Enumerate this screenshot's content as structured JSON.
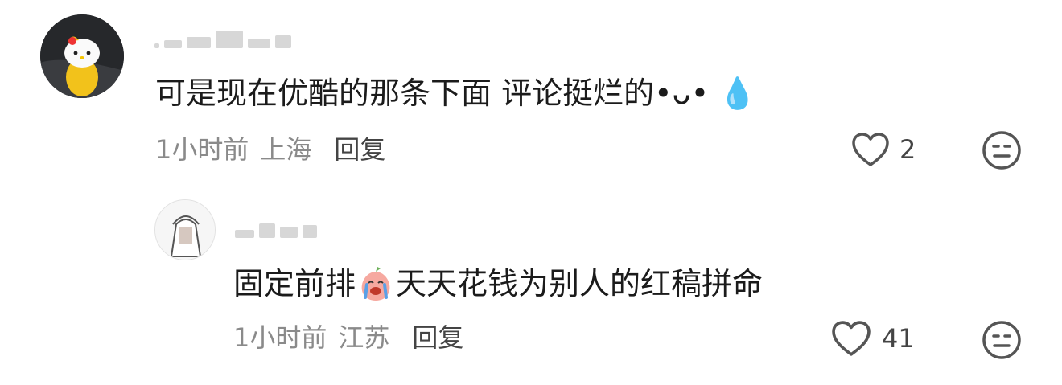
{
  "comments": [
    {
      "text": "可是现在优酷的那条下面 评论挺烂的•ᴗ• 💧",
      "time": "1小时前",
      "location": "上海",
      "reply_label": "回复",
      "likes": "2"
    },
    {
      "text_before_emoji": "固定前排",
      "text_after_emoji": "天天花钱为别人的红稿拼命",
      "time": "1小时前",
      "location": "江苏",
      "reply_label": "回复",
      "likes": "41"
    }
  ],
  "icons": {
    "like": "heart-outline-icon",
    "dislike": "meh-face-icon",
    "inline_emoji": "crying-peach-emoji"
  },
  "colors": {
    "text": "#1b1b1b",
    "meta": "#8a8a8a",
    "icon": "#555555"
  }
}
